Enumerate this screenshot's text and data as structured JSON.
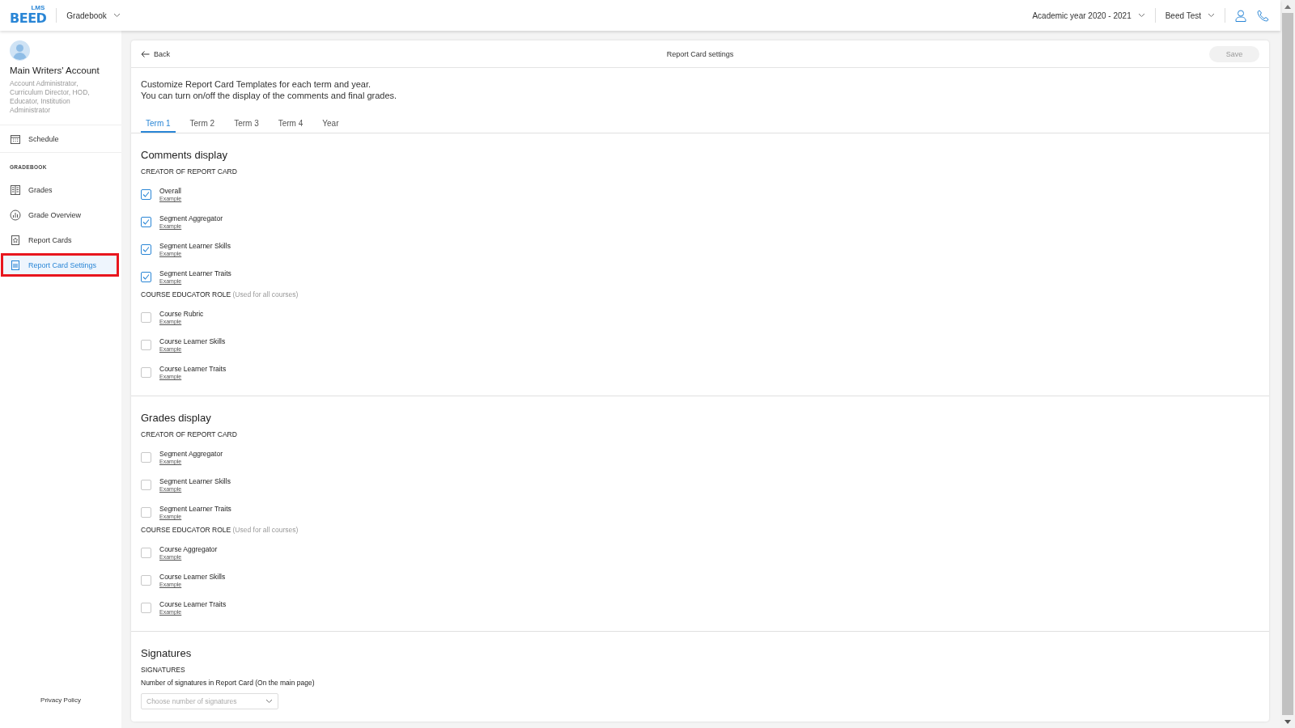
{
  "header": {
    "logo": {
      "badge": "LMS",
      "wordmark": "BEED"
    },
    "module": "Gradebook",
    "academic_year": "Academic year 2020 - 2021",
    "user": "Beed Test"
  },
  "sidebar": {
    "account_name": "Main Writers' Account",
    "roles": "Account Administrator, Curriculum Director, HOD, Educator, Institution Administrator",
    "top_items": [
      {
        "label": "Schedule",
        "selected": false,
        "highlighted": false
      }
    ],
    "section_label": "GRADEBOOK",
    "items": [
      {
        "label": "Grades",
        "selected": false,
        "highlighted": false
      },
      {
        "label": "Grade Overview",
        "selected": false,
        "highlighted": false
      },
      {
        "label": "Report Cards",
        "selected": false,
        "highlighted": false
      },
      {
        "label": "Report Card Settings",
        "selected": true,
        "highlighted": true
      }
    ],
    "footer_link": "Privacy Policy"
  },
  "card": {
    "back": "Back",
    "title": "Report Card settings",
    "save": {
      "label": "Save",
      "disabled": true
    },
    "intro": [
      "Customize Report Card Templates for each term and year.",
      "You can turn on/off the display of the comments and final grades."
    ],
    "tabs": [
      {
        "label": "Term 1",
        "selected": true
      },
      {
        "label": "Term 2",
        "selected": false
      },
      {
        "label": "Term 3",
        "selected": false
      },
      {
        "label": "Term 4",
        "selected": false
      },
      {
        "label": "Year",
        "selected": false
      }
    ],
    "sections": [
      {
        "title": "Comments display",
        "groups": [
          {
            "label": "CREATOR OF REPORT CARD",
            "options": [
              {
                "label": "Overall",
                "link": "Example",
                "checked": true
              },
              {
                "label": "Segment Aggregator",
                "link": "Example",
                "checked": true
              },
              {
                "label": "Segment Learner Skills",
                "link": "Example",
                "checked": true
              },
              {
                "label": "Segment Learner Traits",
                "link": "Example",
                "checked": true
              }
            ]
          },
          {
            "label": "COURSE EDUCATOR ROLE",
            "note": "(Used for all courses)",
            "options": [
              {
                "label": "Course Rubric",
                "link": "Example",
                "checked": false
              },
              {
                "label": "Course Learner Skills",
                "link": "Example",
                "checked": false
              },
              {
                "label": "Course Learner Traits",
                "link": "Example",
                "checked": false
              }
            ]
          }
        ]
      },
      {
        "title": "Grades display",
        "groups": [
          {
            "label": "CREATOR OF REPORT CARD",
            "options": [
              {
                "label": "Segment Aggregator",
                "link": "Example",
                "checked": false
              },
              {
                "label": "Segment Learner Skills",
                "link": "Example",
                "checked": false
              },
              {
                "label": "Segment Learner Traits",
                "link": "Example",
                "checked": false
              }
            ]
          },
          {
            "label": "COURSE EDUCATOR ROLE",
            "note": "(Used for all courses)",
            "options": [
              {
                "label": "Course Aggregator",
                "link": "Example",
                "checked": false
              },
              {
                "label": "Course Learner Skills",
                "link": "Example",
                "checked": false
              },
              {
                "label": "Course Learner Traits",
                "link": "Example",
                "checked": false
              }
            ]
          }
        ]
      }
    ],
    "signatures": {
      "title": "Signatures",
      "label": "SIGNATURES",
      "description": "Number of signatures in Report Card (On the main page)",
      "select": {
        "placeholder": "Choose number of signatures"
      }
    }
  }
}
